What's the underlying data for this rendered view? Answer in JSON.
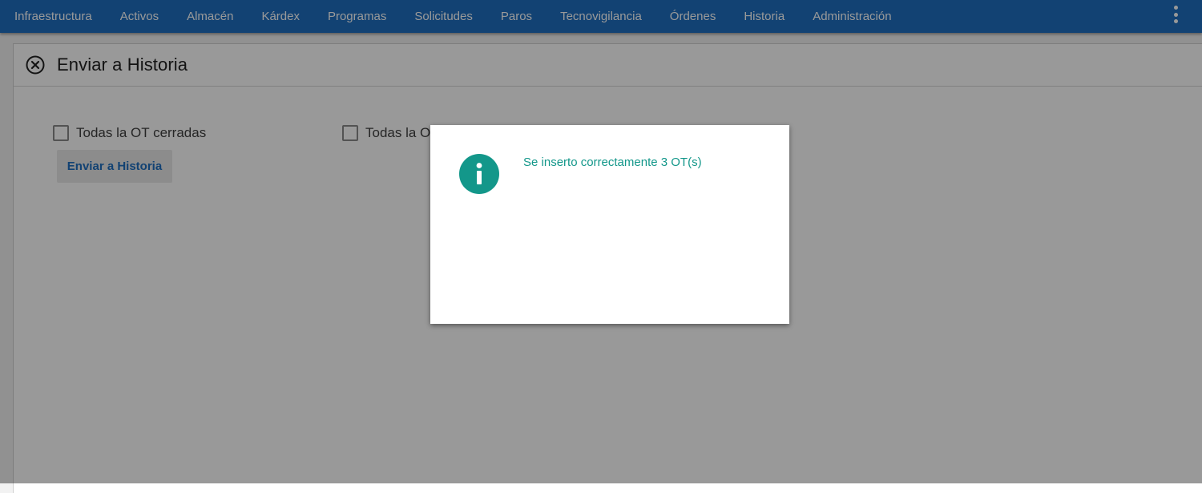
{
  "nav": {
    "items": [
      {
        "label": "Infraestructura"
      },
      {
        "label": "Activos"
      },
      {
        "label": "Almacén"
      },
      {
        "label": "Kárdex"
      },
      {
        "label": "Programas"
      },
      {
        "label": "Solicitudes"
      },
      {
        "label": "Paros"
      },
      {
        "label": "Tecnovigilancia"
      },
      {
        "label": "Órdenes"
      },
      {
        "label": "Historia"
      },
      {
        "label": "Administración"
      }
    ],
    "menu_icon": "more-vertical-icon",
    "color": "#1e6fc0"
  },
  "panel": {
    "title": "Enviar a Historia",
    "close_icon": "close-circle-icon",
    "options": [
      {
        "label": "Todas la OT cerradas"
      },
      {
        "label": "Todas la O"
      },
      {
        "label": ""
      }
    ],
    "button_label": "Enviar a Historia"
  },
  "dialog": {
    "icon": "info-icon",
    "message": "Se inserto correctamente 3 OT(s)",
    "accent": "#13978a"
  }
}
